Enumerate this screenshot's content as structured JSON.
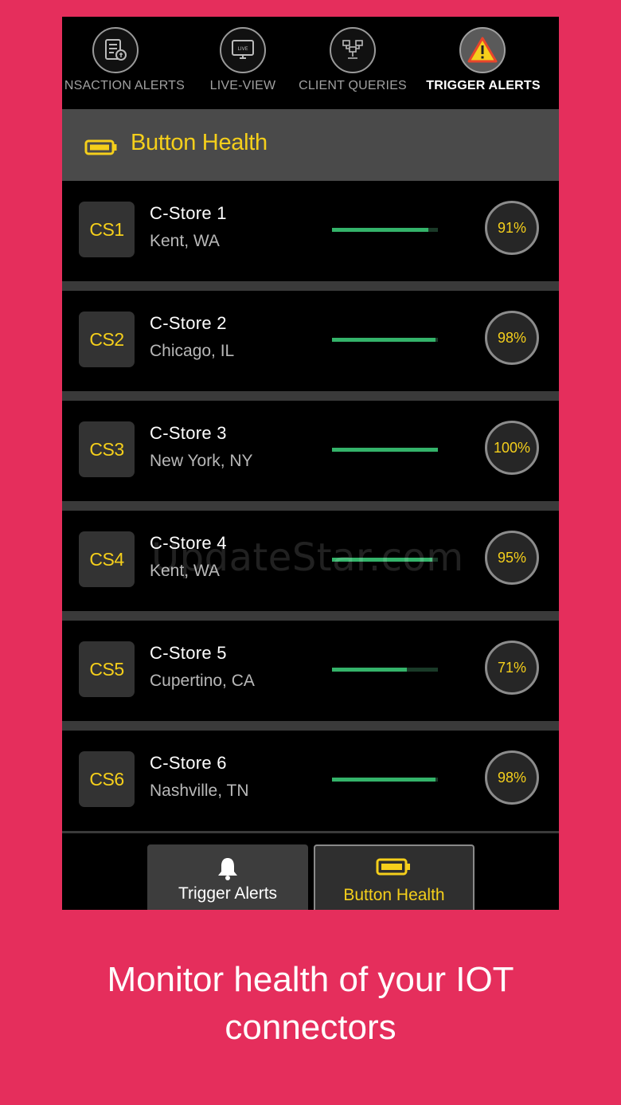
{
  "top_tabs": [
    {
      "label": "NSACTION ALERTS",
      "icon": "transaction-alerts-icon"
    },
    {
      "label": "LIVE-VIEW",
      "icon": "live-view-icon",
      "icon_text": "LIVE"
    },
    {
      "label": "CLIENT QUERIES",
      "icon": "client-queries-icon"
    },
    {
      "label": "TRIGGER ALERTS",
      "icon": "warning-icon",
      "active": true
    }
  ],
  "header": {
    "title": "Button Health",
    "icon": "battery-icon"
  },
  "stores": [
    {
      "code": "CS1",
      "name": "C-Store 1",
      "location": "Kent, WA",
      "health": 91,
      "health_label": "91%"
    },
    {
      "code": "CS2",
      "name": "C-Store 2",
      "location": "Chicago, IL",
      "health": 98,
      "health_label": "98%"
    },
    {
      "code": "CS3",
      "name": "C-Store 3",
      "location": "New York, NY",
      "health": 100,
      "health_label": "100%"
    },
    {
      "code": "CS4",
      "name": "C-Store 4",
      "location": "Kent, WA",
      "health": 95,
      "health_label": "95%"
    },
    {
      "code": "CS5",
      "name": "C-Store 5",
      "location": "Cupertino, CA",
      "health": 71,
      "health_label": "71%"
    },
    {
      "code": "CS6",
      "name": "C-Store 6",
      "location": "Nashville, TN",
      "health": 98,
      "health_label": "98%"
    }
  ],
  "bottom_tabs": [
    {
      "label": "Trigger Alerts",
      "icon": "bell-icon"
    },
    {
      "label": "Button Health",
      "icon": "battery-icon",
      "active": true
    }
  ],
  "watermark": "UpdateStar.com",
  "caption": {
    "line1": "Monitor health of your IOT",
    "line2": "connectors"
  },
  "colors": {
    "background": "#e52e5c",
    "accent": "#f5cf1b",
    "health_bar": "#34b36a",
    "warning": "#e8452c"
  }
}
